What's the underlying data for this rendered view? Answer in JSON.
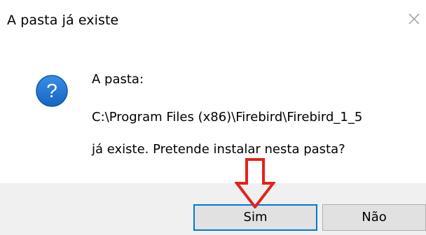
{
  "dialog": {
    "title": "A pasta já existe",
    "close_icon": "close-icon",
    "icon": "question-icon",
    "accent_color": "#0078d7",
    "message": {
      "line1": "A pasta:",
      "line2": "C:\\Program Files (x86)\\Firebird\\Firebird_1_5",
      "line3": "já existe. Pretende instalar nesta pasta?"
    },
    "buttons": {
      "yes_label": "Sim",
      "no_label": "Não"
    },
    "annotation": {
      "icon": "red-down-arrow-icon",
      "color": "#e2231a"
    }
  }
}
